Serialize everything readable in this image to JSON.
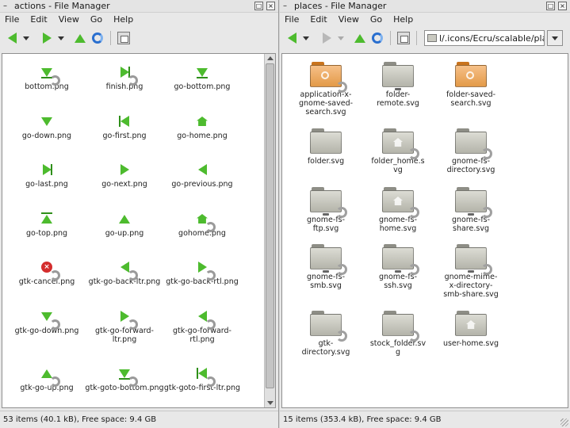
{
  "left": {
    "title": "actions - File Manager",
    "wm_icon": "–",
    "menu": [
      {
        "label": "File"
      },
      {
        "label": "Edit"
      },
      {
        "label": "View"
      },
      {
        "label": "Go"
      },
      {
        "label": "Help"
      }
    ],
    "items": [
      {
        "name": "bottom.png",
        "icon": "go-bottom-link"
      },
      {
        "name": "finish.png",
        "icon": "go-last-link"
      },
      {
        "name": "go-bottom.png",
        "icon": "go-bottom"
      },
      {
        "name": "go-down.png",
        "icon": "go-down"
      },
      {
        "name": "go-first.png",
        "icon": "go-first"
      },
      {
        "name": "go-home.png",
        "icon": "go-home"
      },
      {
        "name": "go-last.png",
        "icon": "go-last"
      },
      {
        "name": "go-next.png",
        "icon": "go-next"
      },
      {
        "name": "go-previous.png",
        "icon": "go-previous"
      },
      {
        "name": "go-top.png",
        "icon": "go-top"
      },
      {
        "name": "go-up.png",
        "icon": "go-up"
      },
      {
        "name": "gohome.png",
        "icon": "go-home-link"
      },
      {
        "name": "gtk-cancel.png",
        "icon": "cancel-link"
      },
      {
        "name": "gtk-go-back-ltr.png",
        "icon": "go-previous-link"
      },
      {
        "name": "gtk-go-back-rtl.png",
        "icon": "go-next-link"
      },
      {
        "name": "gtk-go-down.png",
        "icon": "go-down-link"
      },
      {
        "name": "gtk-go-forward-ltr.png",
        "icon": "go-next-link"
      },
      {
        "name": "gtk-go-forward-rtl.png",
        "icon": "go-previous-link"
      },
      {
        "name": "gtk-go-up.png",
        "icon": "go-up-link"
      },
      {
        "name": "gtk-goto-bottom.png",
        "icon": "go-bottom-link"
      },
      {
        "name": "gtk-goto-first-ltr.png",
        "icon": "go-first-link"
      }
    ],
    "status": "53 items (40.1 kB), Free space: 9.4 GB"
  },
  "right": {
    "title": "places - File Manager",
    "wm_icon": "–",
    "menu": [
      {
        "label": "File"
      },
      {
        "label": "Edit"
      },
      {
        "label": "View"
      },
      {
        "label": "Go"
      },
      {
        "label": "Help"
      }
    ],
    "path": "l/.icons/Ecru/scalable/places",
    "items": [
      {
        "name": "application-x-gnome-saved-search.svg",
        "icon": "folder-saved-search-link",
        "color": "orange"
      },
      {
        "name": "folder-remote.svg",
        "icon": "folder-remote",
        "color": "gray"
      },
      {
        "name": "folder-saved-search.svg",
        "icon": "folder-saved-search",
        "color": "orange"
      },
      {
        "name": "folder.svg",
        "icon": "folder",
        "color": "gray"
      },
      {
        "name": "folder_home.svg",
        "icon": "folder-home-link",
        "color": "gray"
      },
      {
        "name": "gnome-fs-directory.svg",
        "icon": "folder-link",
        "color": "gray"
      },
      {
        "name": "gnome-fs-ftp.svg",
        "icon": "folder-remote-link",
        "color": "gray"
      },
      {
        "name": "gnome-fs-home.svg",
        "icon": "folder-home-link",
        "color": "gray"
      },
      {
        "name": "gnome-fs-share.svg",
        "icon": "folder-remote-link",
        "color": "gray"
      },
      {
        "name": "gnome-fs-smb.svg",
        "icon": "folder-remote-link",
        "color": "gray"
      },
      {
        "name": "gnome-fs-ssh.svg",
        "icon": "folder-remote-link",
        "color": "gray"
      },
      {
        "name": "gnome-mime-x-directory-smb-share.svg",
        "icon": "folder-remote-link",
        "color": "gray"
      },
      {
        "name": "gtk-directory.svg",
        "icon": "folder-link",
        "color": "gray"
      },
      {
        "name": "stock_folder.svg",
        "icon": "folder-link",
        "color": "gray"
      },
      {
        "name": "user-home.svg",
        "icon": "folder-home",
        "color": "gray"
      }
    ],
    "status": "15 items (353.4 kB), Free space: 9.4 GB"
  }
}
